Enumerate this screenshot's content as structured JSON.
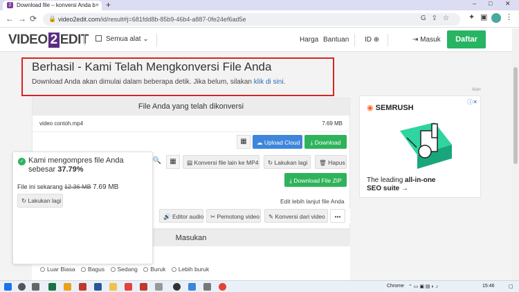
{
  "browser": {
    "tab_title": "Download file – konversi Anda b",
    "tab_close": "×",
    "new_tab": "+",
    "win_controls": [
      "–",
      "□",
      "✕"
    ],
    "url_domain": "video2edit.com",
    "url_path": "/id/result#j=681fdd8b-85b9-46b4-a887-0fe24ef6ad5e",
    "nav": [
      "←",
      "→",
      "⟳"
    ]
  },
  "site": {
    "logo_a": "VIDEO",
    "logo_b": "2",
    "logo_c": "EDIT",
    "all_tools": "Semua alat",
    "harga": "Harga",
    "bantuan": "Bantuan",
    "lang": "ID",
    "masuk": "Masuk",
    "daftar": "Daftar"
  },
  "hero": {
    "title": "Berhasil - Kami Telah Mengkonversi File Anda",
    "desc": "Download Anda akan dimulai dalam beberapa detik. Jika belum, silakan",
    "link": "klik di sini",
    "period": "."
  },
  "panel": {
    "header": "File Anda yang telah dikonversi",
    "file_name": "video contoh.mp4",
    "file_size": "7.69 MB",
    "upload_cloud": "Upload Cloud",
    "download": "Download",
    "convert_other": "Konversi file lain ke MP4",
    "do_again": "Lakukan lagi",
    "delete": "Hapus",
    "download_zip": "Download File ZIP",
    "edit_further": "Edit lebih lanjut file Anda",
    "audio_editor": "Editor audio",
    "video_cutter": "Pemotong video",
    "convert_video": "Konversi dari video",
    "more": "•••"
  },
  "masukan": {
    "header": "Masukan",
    "options": [
      "Luar Biasa",
      "Bagus",
      "Sedang",
      "Buruk",
      "Lebih buruk"
    ]
  },
  "toast": {
    "msg": "Kami mengompres file Anda sebesar",
    "percent": "37.79%",
    "now_label": "File ini sekarang",
    "old_size": "12.36 MB",
    "new_size": "7.69 MB",
    "redo": "Lakukan lagi"
  },
  "ad": {
    "label": "Iklan",
    "brand": "SEMRUSH",
    "line1": "The leading",
    "line1b": "all-in-one",
    "line2": "SEO suite",
    "line2b": "→"
  },
  "taskbar": {
    "chrome_label": "Chrome",
    "time": "15:46"
  }
}
